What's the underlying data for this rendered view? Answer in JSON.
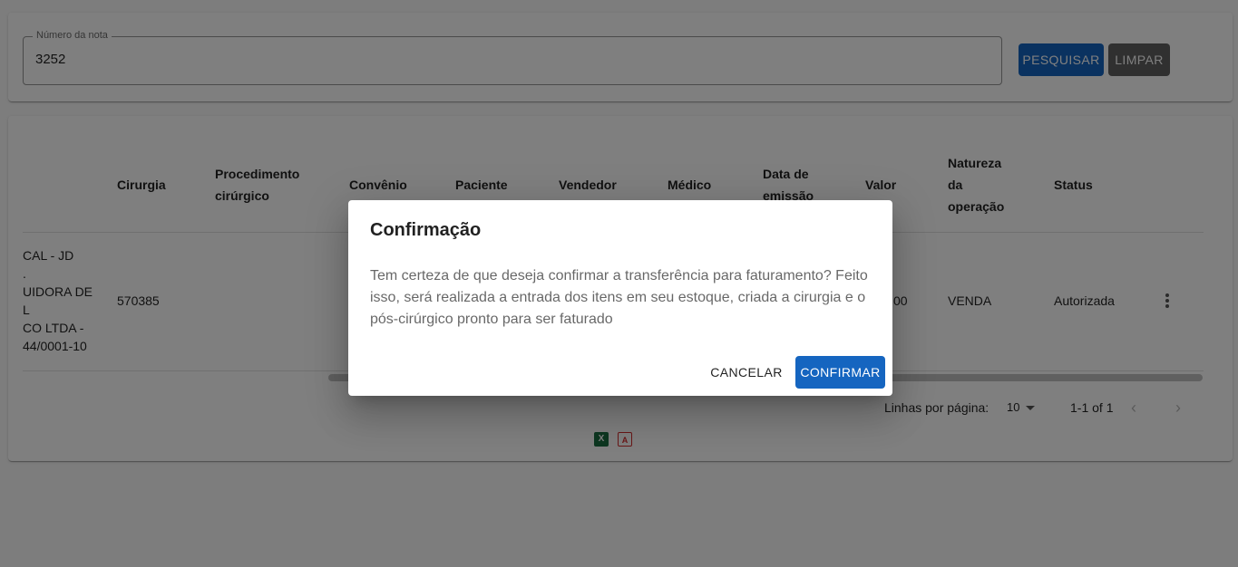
{
  "search": {
    "label": "Número da nota",
    "value": "3252",
    "search_button": "PESQUISAR",
    "clear_button": "LIMPAR"
  },
  "table": {
    "headers": {
      "cirurgia": "Cirurgia",
      "procedimento_1": "Procedimento",
      "procedimento_2": "cirúrgico",
      "convenio": "Convênio",
      "paciente": "Paciente",
      "vendedor": "Vendedor",
      "medico": "Médico",
      "data_1": "Data de",
      "data_2": "emissão",
      "valor": "Valor",
      "natureza_1": "Natureza",
      "natureza_2": "da",
      "natureza_3": "operação",
      "status": "Status"
    },
    "row": {
      "cliente_lines": [
        "CAL - JD",
        ".",
        "UIDORA DE",
        "L",
        "CO LTDA -",
        "44/0001-10"
      ],
      "cirurgia": "570385",
      "valor_partial": "00",
      "natureza": "VENDA",
      "status": "Autorizada"
    },
    "footer": {
      "rows_per_page_label": "Linhas por página:",
      "rows_per_page_value": "10",
      "range": "1-1 of 1",
      "prev_icon": "chevron-left-icon",
      "next_icon": "chevron-right-icon"
    },
    "exports": {
      "excel_icon": "excel-icon",
      "excel_glyph": "X",
      "pdf_icon": "pdf-icon",
      "pdf_glyph": "A"
    }
  },
  "dialog": {
    "title": "Confirmação",
    "body": "Tem certeza de que deseja confirmar a transferência para faturamento? Feito isso, será realizada a entrada dos itens em seu estoque, criada a cirurgia e o pós-cirúrgico pronto para ser faturado",
    "cancel": "CANCELAR",
    "confirm": "CONFIRMAR"
  },
  "colors": {
    "primary": "#1565c0",
    "clear_button": "#616161",
    "backdrop": "rgba(0,0,0,0.5)"
  }
}
